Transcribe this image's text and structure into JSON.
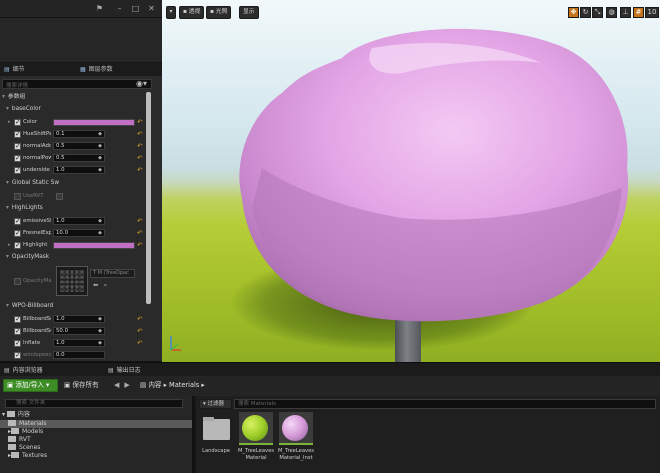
{
  "details_tabs": {
    "details": "细节",
    "scene_params": "图层参数"
  },
  "details": {
    "search_placeholder": "搜索详情",
    "param_group": "参数组",
    "categories": {
      "basecolor": "baseColor",
      "global_static": "Global Static Sw",
      "highlights": "HighLights",
      "opacity_mask": "OpacityMask",
      "wpo_billboard": "WPO-Billboard"
    },
    "basecolor_rows": [
      {
        "label": "Color",
        "value": ""
      },
      {
        "label": "HueShiftPe",
        "value": "0.1"
      },
      {
        "label": "normalAdd",
        "value": "0.5"
      },
      {
        "label": "normalPow",
        "value": "0.5"
      },
      {
        "label": "underside",
        "value": "1.0"
      }
    ],
    "global_rows": [
      {
        "label": "UseRVT"
      }
    ],
    "highlight_rows": [
      {
        "label": "emissiveSt",
        "value": "1.0"
      },
      {
        "label": "FresnelExp",
        "value": "10.0"
      },
      {
        "label": "Highlight",
        "value": ""
      }
    ],
    "opacity_rows": [
      {
        "label": "OpacityMas",
        "texture": "T M (TreeOpac"
      }
    ],
    "wpo_rows": [
      {
        "label": "BillboardSc",
        "value": "1.0"
      },
      {
        "label": "BillboardSc",
        "value": "50.0"
      },
      {
        "label": "Inflate",
        "value": "1.0"
      },
      {
        "label": "windspeed",
        "value": "0.0"
      }
    ]
  },
  "viewport": {
    "perspective": "透视",
    "lit": "光照",
    "show": "显示",
    "grid_size": "10"
  },
  "bottom_tabs": {
    "content_browser": "内容浏览器",
    "output_log": "输出日志"
  },
  "content_toolbar": {
    "add_import": "添加/导入",
    "save_all": "保存所有",
    "crumb_root": "内容",
    "crumb_sep": "▸",
    "crumb_folder": "Materials"
  },
  "tree": {
    "search_placeholder": "搜索 文件夹",
    "root": "内容",
    "nodes": [
      "Materials",
      "Models",
      "RVT",
      "Scenes",
      "Textures"
    ]
  },
  "assets": {
    "filter_label": "过滤器",
    "search_placeholder": "搜索 Materials",
    "items": [
      {
        "name": "Landscape"
      },
      {
        "name": "M_TreeLeaves Material"
      },
      {
        "name": "M_TreeLeaves Material_Inst"
      }
    ]
  },
  "colors": {
    "leaf_color": "#c06ec6",
    "accent_orange": "#c5731b",
    "add_button": "#3d8c26"
  }
}
